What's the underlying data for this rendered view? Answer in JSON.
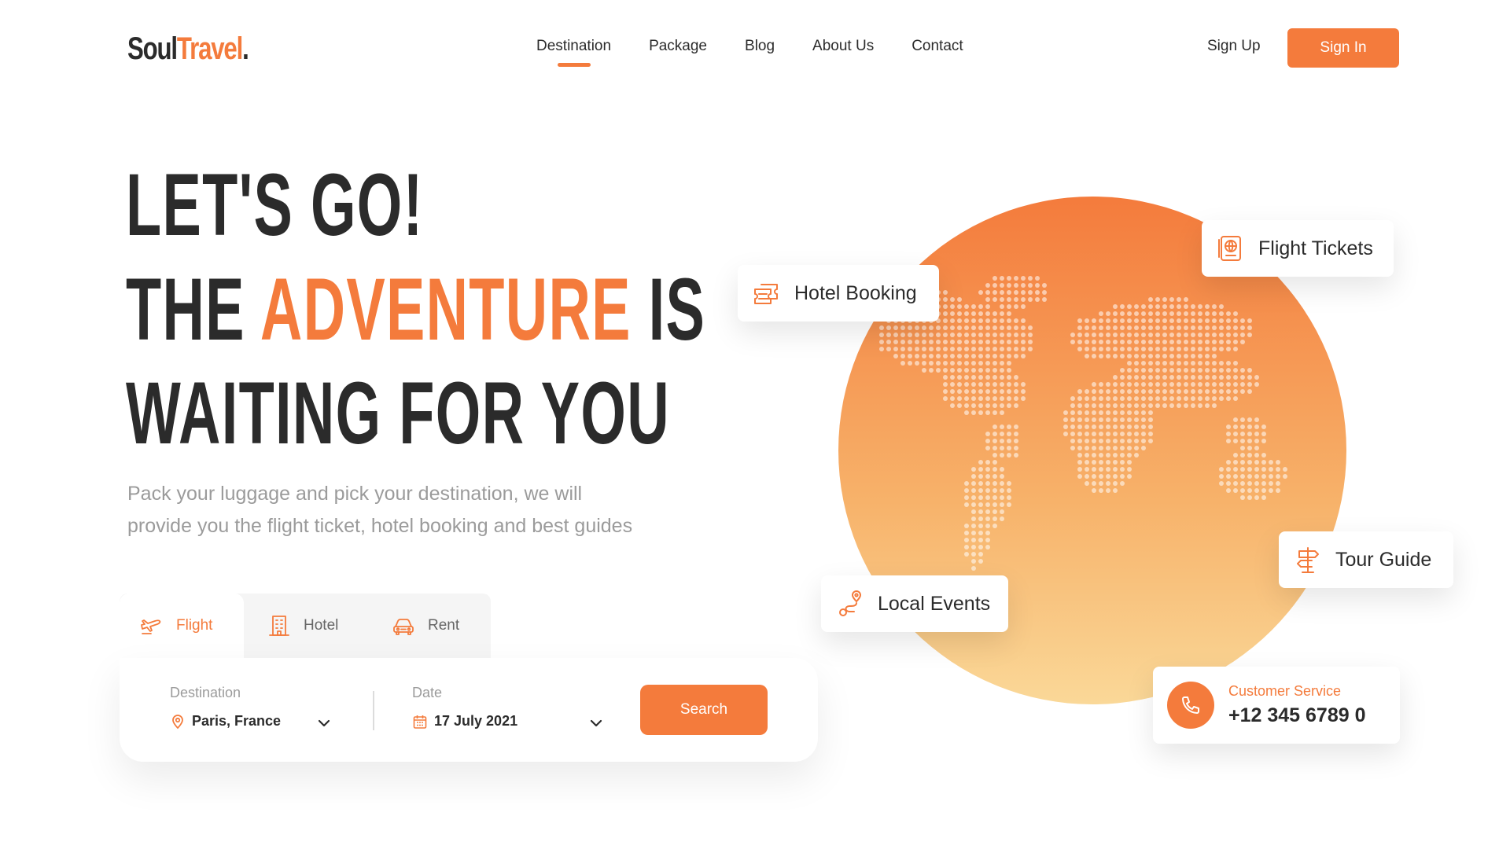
{
  "brand": {
    "part1": "Soul",
    "part2": "Travel",
    "dot": ".",
    "accent_color": "#f47b3c"
  },
  "nav": {
    "items": [
      {
        "label": "Destination",
        "active": true
      },
      {
        "label": "Package",
        "active": false
      },
      {
        "label": "Blog",
        "active": false
      },
      {
        "label": "About Us",
        "active": false
      },
      {
        "label": "Contact",
        "active": false
      }
    ]
  },
  "auth": {
    "sign_up": "Sign Up",
    "sign_in": "Sign In"
  },
  "hero": {
    "line1": "LET'S GO!",
    "line2_pre": "THE ",
    "line2_accent": "ADVENTURE",
    "line2_post": " IS",
    "line3": "WAITING FOR YOU",
    "subtitle": "Pack your luggage and pick your destination, we will provide you the flight ticket, hotel booking and best guides"
  },
  "booking": {
    "tabs": [
      {
        "label": "Flight",
        "icon": "plane-icon",
        "active": true
      },
      {
        "label": "Hotel",
        "icon": "building-icon",
        "active": false
      },
      {
        "label": "Rent",
        "icon": "car-icon",
        "active": false
      }
    ],
    "destination": {
      "label": "Destination",
      "value": "Paris, France",
      "icon": "location-pin-icon"
    },
    "date": {
      "label": "Date",
      "value": "17 July 2021",
      "icon": "calendar-icon"
    },
    "search_label": "Search"
  },
  "features": {
    "hotel_booking": {
      "label": "Hotel Booking",
      "icon": "hotel-ticket-icon"
    },
    "flight_tickets": {
      "label": "Flight Tickets",
      "icon": "passport-icon"
    },
    "tour_guide": {
      "label": "Tour Guide",
      "icon": "signpost-icon"
    },
    "local_events": {
      "label": "Local Events",
      "icon": "route-icon"
    }
  },
  "customer_service": {
    "label": "Customer Service",
    "number": "+12 345 6789 0",
    "icon": "phone-icon"
  },
  "colors": {
    "accent": "#f47b3c",
    "text_dark": "#2b2b2b",
    "text_muted": "#9b9b9b",
    "globe_top": "#f47b3c",
    "globe_bottom": "#fad898"
  }
}
